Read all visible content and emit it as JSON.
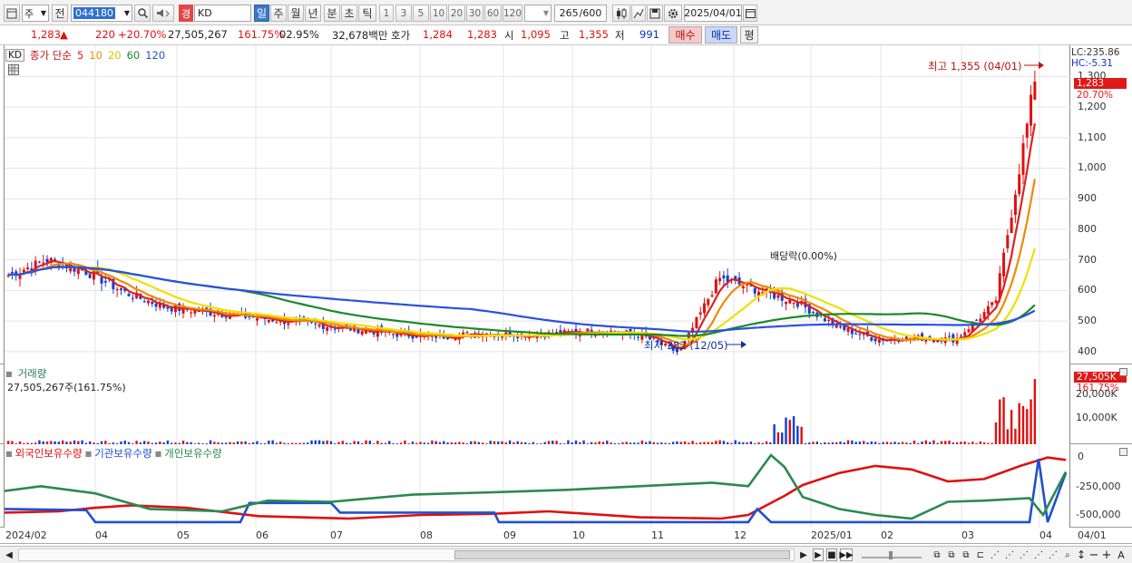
{
  "toolbar": {
    "period_label": "주",
    "compare_label": "전",
    "stock_code": "044180",
    "stock_tag": "경",
    "stock_name": "KD",
    "periods": [
      "일",
      "주",
      "월",
      "년",
      "분",
      "초",
      "틱"
    ],
    "active_period": "일",
    "minute_steps": [
      "1",
      "3",
      "5",
      "10",
      "20",
      "30",
      "60",
      "120"
    ],
    "bar_count": "265",
    "bar_total": "/600",
    "date": "2025/04/01"
  },
  "quote": {
    "price": "1,283",
    "change_arrow": "▲",
    "change": "220",
    "change_pct": "+20.70%",
    "volume": "27,505,267",
    "volume_ratio": "161.75%",
    "turnover": "02.95%",
    "amount": "32,678백만",
    "bid_label": "호가",
    "bid_1": "1,284",
    "bid_2": "1,283",
    "open_label": "시",
    "open": "1,095",
    "high_label": "고",
    "high": "1,355",
    "low_label": "저",
    "low": "991",
    "buy_label": "매수",
    "sell_label": "매도",
    "eval_label": "평"
  },
  "price_panel": {
    "legend_code": "KD",
    "legend_title": "종가 단순",
    "ma_labels": [
      "5",
      "10",
      "20",
      "60",
      "120"
    ],
    "ma_colors": [
      "#e02020",
      "#f08a00",
      "#f0e000",
      "#1a8a2a",
      "#2a50e0"
    ],
    "lc_label": "LC:235.86",
    "hc_label": "HC:-5.31",
    "price_tag": "1,283",
    "pct_tag": "20.70%",
    "y_ticks": [
      "1,300",
      "1,200",
      "1,100",
      "1,000",
      "900",
      "800",
      "700",
      "600",
      "500",
      "400"
    ],
    "high_note": "최고 1,355 (04/01)",
    "low_note": "최저 382 (12/05)",
    "event_note": "배당락(0.00%)"
  },
  "volume_panel": {
    "title": "거래량",
    "value": "27,505,267주(161.75%)",
    "tag_value": "27,505K",
    "tag_pct": "161.75%",
    "y_ticks": [
      "20,000K",
      "10,000K"
    ]
  },
  "holding_panel": {
    "legend": [
      "외국인보유수량",
      "기관보유수량",
      "개인보유수량"
    ],
    "legend_colors": [
      "#e01010",
      "#2050d0",
      "#2a8a50"
    ],
    "y_ticks": [
      "0",
      "-250,000",
      "-500,000"
    ]
  },
  "x_axis": [
    "2024/02",
    "04",
    "05",
    "06",
    "07",
    "08",
    "09",
    "10",
    "11",
    "12",
    "2025/01",
    "02",
    "03",
    "04",
    "04/01"
  ],
  "chart_data": {
    "type": "candlestick",
    "y_range": [
      370,
      1360
    ],
    "x_labels": [
      "2024/02",
      "04",
      "05",
      "06",
      "07",
      "08",
      "09",
      "10",
      "11",
      "12",
      "2025/01",
      "02",
      "03",
      "04"
    ],
    "close_series": [
      650,
      700,
      660,
      590,
      545,
      530,
      515,
      500,
      485,
      470,
      455,
      450,
      460,
      455,
      460,
      470,
      455,
      395,
      640,
      600,
      560,
      480,
      440,
      445,
      440,
      560,
      1283
    ],
    "high": 1355,
    "high_date": "04/01",
    "low": 382,
    "low_date": "12/05",
    "last_price": 1283,
    "last_volume": 27505267
  }
}
